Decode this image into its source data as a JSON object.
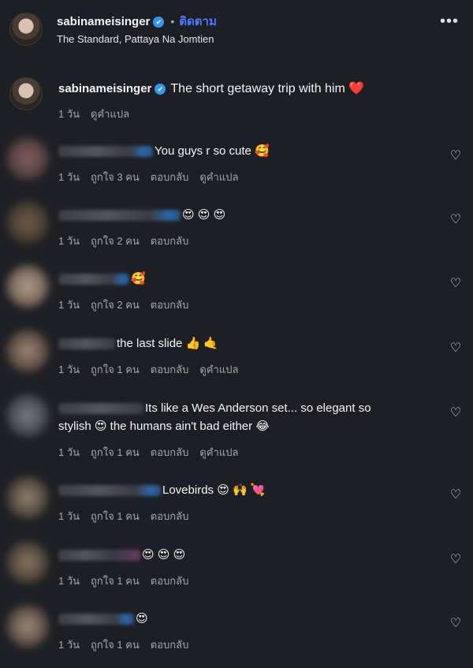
{
  "header": {
    "username": "sabinameisinger",
    "verified_icon": "✔",
    "follow_label": "ติดตาม",
    "location": "The Standard, Pattaya Na Jomtien",
    "more_icon": "•••"
  },
  "caption": {
    "username": "sabinameisinger",
    "text": "The short getaway trip with him ❤️",
    "time": "1 วัน",
    "translate": "ดูคำแปล"
  },
  "comments": [
    {
      "text": "You guys r so cute 🥰",
      "time": "1 วัน",
      "likes": "ถูกใจ 3 คน",
      "reply": "ตอบกลับ",
      "translate": "ดูคำแปล"
    },
    {
      "text": "😍 😍 😍",
      "time": "1 วัน",
      "likes": "ถูกใจ 2 คน",
      "reply": "ตอบกลับ"
    },
    {
      "text": "🥰",
      "time": "1 วัน",
      "likes": "ถูกใจ 2 คน",
      "reply": "ตอบกลับ"
    },
    {
      "text": "the last slide 👍 🤙",
      "time": "1 วัน",
      "likes": "ถูกใจ 1 คน",
      "reply": "ตอบกลับ",
      "translate": "ดูคำแปล"
    },
    {
      "text": "Its like a Wes Anderson set... so elegant so",
      "text2": "stylish 😍 the humans ain't bad either 😂",
      "time": "1 วัน",
      "likes": "ถูกใจ 1 คน",
      "reply": "ตอบกลับ",
      "translate": "ดูคำแปล"
    },
    {
      "text": "Lovebirds 😍 🙌 💘",
      "time": "1 วัน",
      "likes": "ถูกใจ 1 คน",
      "reply": "ตอบกลับ"
    },
    {
      "text": "😍 😍 😍",
      "time": "1 วัน",
      "likes": "ถูกใจ 1 คน",
      "reply": "ตอบกลับ"
    },
    {
      "text": "😍",
      "time": "1 วัน",
      "likes": "ถูกใจ 1 คน",
      "reply": "ตอบกลับ"
    }
  ],
  "icons": {
    "heart": "heart-outline-icon",
    "verified": "verified-badge-icon"
  },
  "colors": {
    "background": "#1e1f24",
    "follow": "#4a7bff",
    "verified": "#3797f0",
    "meta": "#a8a8a8"
  }
}
